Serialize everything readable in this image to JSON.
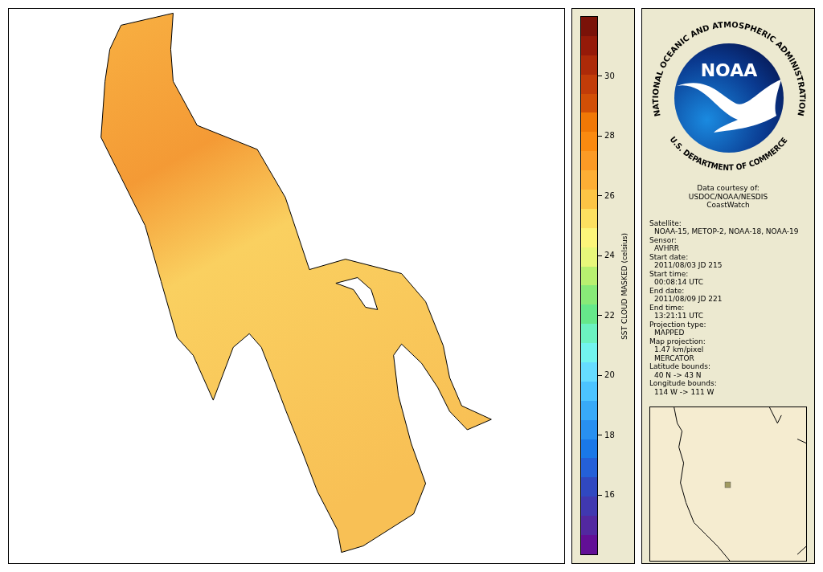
{
  "colorbar": {
    "title": "SST CLOUD MASKED (celsius)",
    "ticks": [
      "30",
      "28",
      "26",
      "24",
      "22",
      "20",
      "18",
      "16"
    ]
  },
  "logo": {
    "acronym": "NOAA",
    "top_text": "NATIONAL OCEANIC AND ATMOSPHERIC ADMINISTRATION",
    "bottom_text": "U.S. DEPARTMENT OF COMMERCE"
  },
  "courtesy": [
    "Data courtesy of:",
    "USDOC/NOAA/NESDIS",
    "CoastWatch"
  ],
  "fields": [
    {
      "label": "Satellite:",
      "values": [
        "NOAA-15, METOP-2, NOAA-18, NOAA-19"
      ]
    },
    {
      "label": "Sensor:",
      "values": [
        "AVHRR"
      ]
    },
    {
      "label": "Start date:",
      "values": [
        "2011/08/03 JD 215"
      ]
    },
    {
      "label": "Start time:",
      "values": [
        "00:08:14 UTC"
      ]
    },
    {
      "label": "End date:",
      "values": [
        "2011/08/09 JD 221"
      ]
    },
    {
      "label": "End time:",
      "values": [
        "13:21:11 UTC"
      ]
    },
    {
      "label": "Projection type:",
      "values": [
        "MAPPED"
      ]
    },
    {
      "label": "Map projection:",
      "values": [
        "1.47 km/pixel",
        "MERCATOR"
      ]
    },
    {
      "label": "Latitude bounds:",
      "values": [
        "40 N -> 43 N"
      ]
    },
    {
      "label": "Longitude bounds:",
      "values": [
        "114 W -> 111 W"
      ]
    }
  ]
}
